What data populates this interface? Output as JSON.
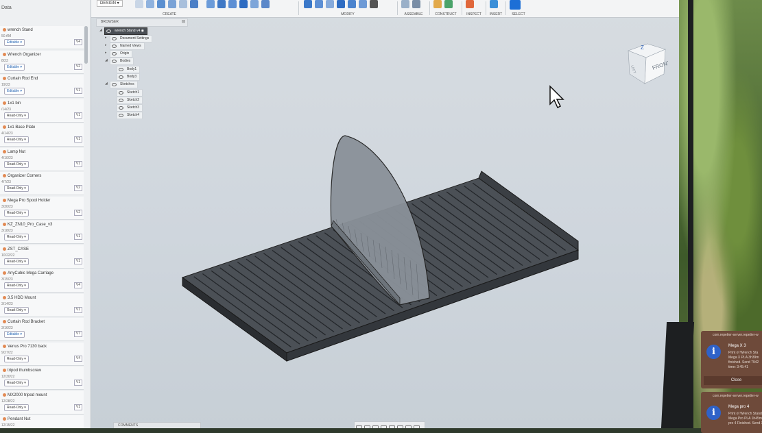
{
  "left_panel": {
    "header": "Data",
    "projects": [
      {
        "name": "wrench Stand",
        "date": "50 AM",
        "status": "Editable",
        "version": "V4"
      },
      {
        "name": "Wrench Organizer",
        "date": "8/23",
        "status": "Editable",
        "version": "V2"
      },
      {
        "name": "Curtain Rod End",
        "date": "19/23",
        "status": "Editable",
        "version": "V1"
      },
      {
        "name": "1x1 bin",
        "date": "/14/23",
        "status": "Read-Only",
        "version": "V1"
      },
      {
        "name": "1x1 Base Plate",
        "date": "4/14/23",
        "status": "Read-Only",
        "version": "V1"
      },
      {
        "name": "Lamp Nut",
        "date": "4/10/23",
        "status": "Read-Only",
        "version": "V1"
      },
      {
        "name": "Organizer Corners",
        "date": "4/7/23",
        "status": "Read-Only",
        "version": "V2"
      },
      {
        "name": "Mega Pro Spool Holder",
        "date": "3/30/23",
        "status": "Read-Only",
        "version": "V2"
      },
      {
        "name": "KZ_ZN10_Pro_Case_v3",
        "date": "3/18/23",
        "status": "Read-Only",
        "version": "V1"
      },
      {
        "name": "ZST_CASE",
        "date": "10/22/22",
        "status": "Read-Only",
        "version": "V1"
      },
      {
        "name": "AnyCubic Mega Carriage",
        "date": "3/15/23",
        "status": "Read-Only",
        "version": "V4"
      },
      {
        "name": "3.5 HDD Mount",
        "date": "3/14/23",
        "status": "Read-Only",
        "version": "V1"
      },
      {
        "name": "Curtain Rod Bracket",
        "date": "3/16/23",
        "status": "Editable",
        "version": "V7"
      },
      {
        "name": "Venus Pro 7130 back",
        "date": "9/27/22",
        "status": "Read-Only",
        "version": "V4"
      },
      {
        "name": "tripod thumbscrew",
        "date": "12/30/22",
        "status": "Read-Only",
        "version": "V1"
      },
      {
        "name": "MX2000 tripod mount",
        "date": "12/28/22",
        "status": "Read-Only",
        "version": "V1"
      },
      {
        "name": "Pendant Nut",
        "date": "12/15/22",
        "status": "Read-Only",
        "version": "V1"
      }
    ]
  },
  "toolbar": {
    "workspace": "DESIGN",
    "groups": [
      "CREATE",
      "MODIFY",
      "ASSEMBLE",
      "CONSTRUCT",
      "INSPECT",
      "INSERT",
      "SELECT"
    ]
  },
  "browser": {
    "title": "BROWSER",
    "root": "wrench Stand v4",
    "nodes": [
      "Document Settings",
      "Named Views",
      "Origin",
      "Bodies",
      "Body1",
      "Body3",
      "Sketches",
      "Sketch1",
      "Sketch2",
      "Sketch3",
      "Sketch4"
    ]
  },
  "viewcube": {
    "front": "FRONT",
    "left": "LEFT",
    "z": "Z",
    "x": "X"
  },
  "comments": "COMMENTS",
  "notifications": [
    {
      "header": "com.repetier-server.repetier-w",
      "title": "Mega X 3",
      "body": "Print of Wrench Sta\nMega X PLA 3h39m\nfinished. Send 7942\ntime: 3:45:41",
      "close": "Close"
    },
    {
      "header": "com.repetier-server.repetier-w",
      "title": "Mega pro 4",
      "body": "Print of Wrench Stand\nMega Pro PLA 1h45m\npro 4 Finished. Send 3",
      "close": ""
    }
  ],
  "colors": {
    "model": "#3a3e43",
    "accent": "#1d6fd6",
    "notification": "#6e4a3a"
  }
}
